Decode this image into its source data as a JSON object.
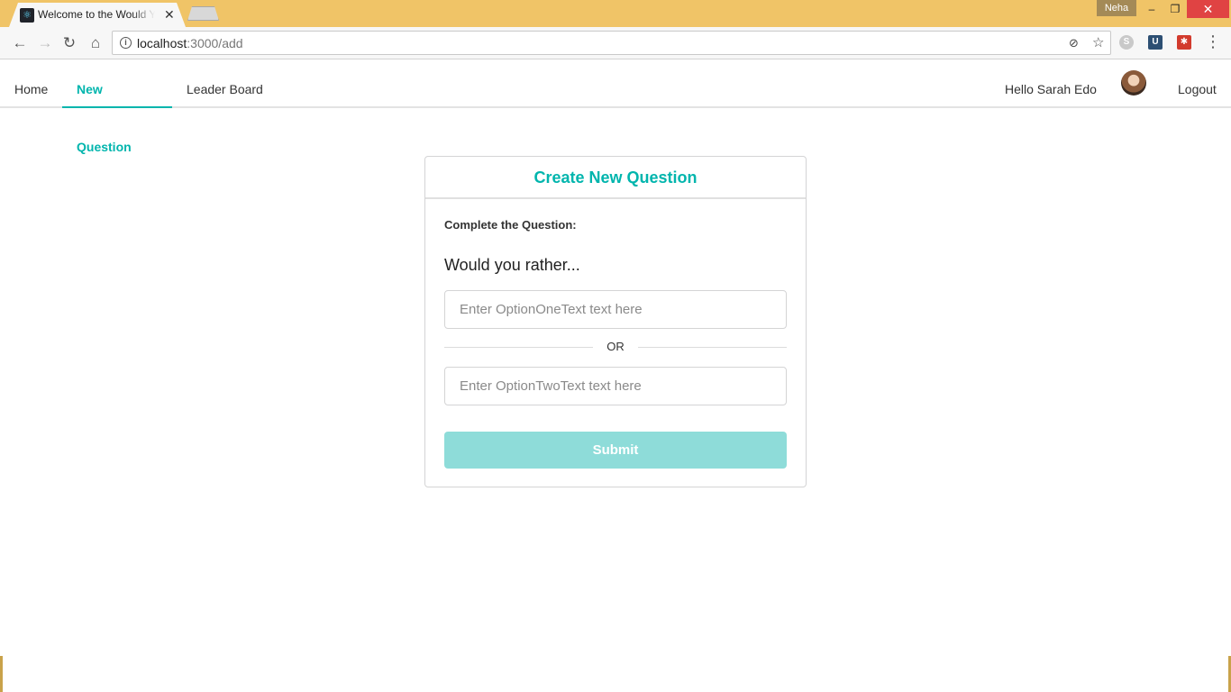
{
  "browser": {
    "tab_title": "Welcome to the Would You Rather App",
    "tab_close": "✕",
    "profile_name": "Neha",
    "window": {
      "minimize": "–",
      "restore": "❐",
      "close": "✕"
    },
    "url_host": "localhost",
    "url_path": ":3000/add",
    "nav": {
      "back": "←",
      "forward": "→",
      "reload": "↻",
      "home": "⌂"
    },
    "menu": "⋮",
    "star": "☆"
  },
  "appnav": {
    "home": "Home",
    "new_question": "New Question",
    "leader_board": "Leader Board",
    "greeting": "Hello Sarah Edo",
    "logout": "Logout"
  },
  "card": {
    "title": "Create New Question",
    "instruction": "Complete the Question:",
    "lead": "Would you rather...",
    "option_one_placeholder": "Enter OptionOneText text here",
    "option_one_value": "",
    "separator": "OR",
    "option_two_placeholder": "Enter OptionTwoText text here",
    "option_two_value": "",
    "submit_label": "Submit"
  },
  "colors": {
    "accent": "#00b5ad",
    "submit_disabled": "#8edcd9",
    "titlebar": "#f0c467"
  }
}
